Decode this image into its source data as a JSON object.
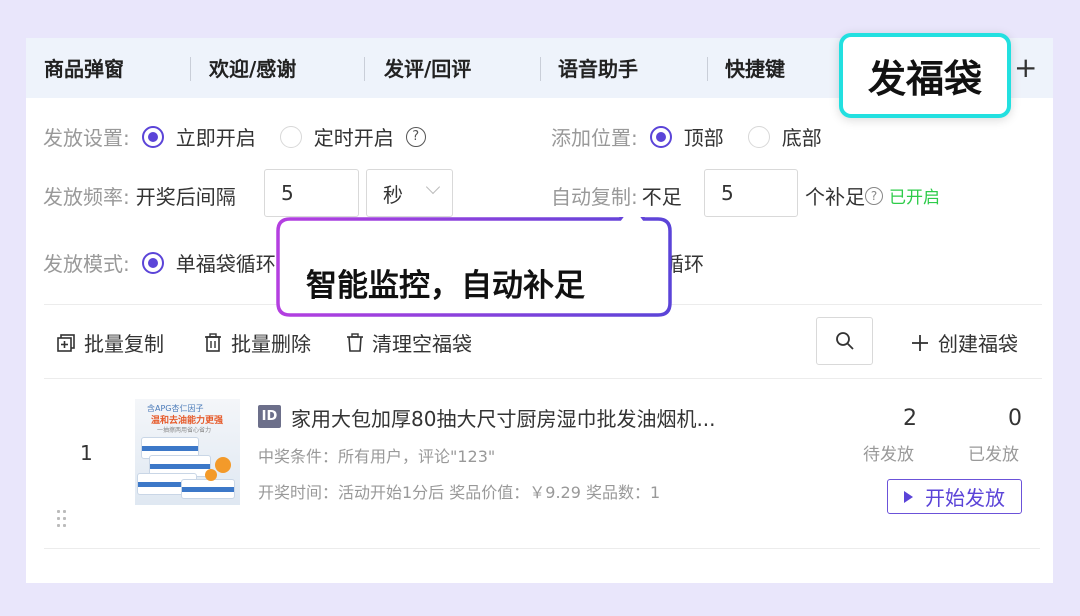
{
  "tabs": [
    {
      "label": "商品弹窗"
    },
    {
      "label": "欢迎/感谢"
    },
    {
      "label": "发评/回评"
    },
    {
      "label": "语音助手"
    },
    {
      "label": "快捷键"
    }
  ],
  "highlighted_tab": {
    "label": "发福袋"
  },
  "add_tab_icon": "plus-icon",
  "settings": {
    "send_setting": {
      "label": "发放设置:",
      "options": [
        "立即开启",
        "定时开启"
      ],
      "selected": "立即开启",
      "help": "?"
    },
    "add_position": {
      "label": "添加位置:",
      "options": [
        "顶部",
        "底部"
      ],
      "selected": "顶部"
    },
    "send_frequency": {
      "label": "发放频率:",
      "prefix": "开奖后间隔",
      "value": "5",
      "unit": "秒"
    },
    "auto_copy": {
      "label": "自动复制:",
      "prefix": "不足",
      "value": "5",
      "suffix": "个补足",
      "help": "?",
      "status": "已开启"
    },
    "send_mode": {
      "label": "发放模式:",
      "option1": "单福袋循环",
      "option2_tail": "循环"
    }
  },
  "callout": {
    "text": "智能监控，自动补足"
  },
  "toolbar": {
    "batch_copy": "批量复制",
    "batch_delete": "批量删除",
    "clear_empty": "清理空福袋",
    "create": "创建福袋"
  },
  "items": [
    {
      "index": "1",
      "thumb_text": {
        "line1": "含APG杏仁因子",
        "line2": "温和去油能力更强",
        "line3": "一抽擦两用省心省力"
      },
      "id_badge": "ID",
      "title": "家用大包加厚80抽大尺寸厨房湿巾批发油烟机...",
      "condition": "中奖条件：所有用户，评论\"123\"",
      "draw_info": "开奖时间：活动开始1分后 奖品价值：￥9.29 奖品数：1",
      "pending_count": "2",
      "pending_label": "待发放",
      "sent_count": "0",
      "sent_label": "已发放",
      "start_button": "开始发放"
    }
  ],
  "colors": {
    "accent": "#5b44d8",
    "highlight_border": "#22e0e0",
    "status_green": "#2ecc4a",
    "background": "#e9e6fb"
  }
}
